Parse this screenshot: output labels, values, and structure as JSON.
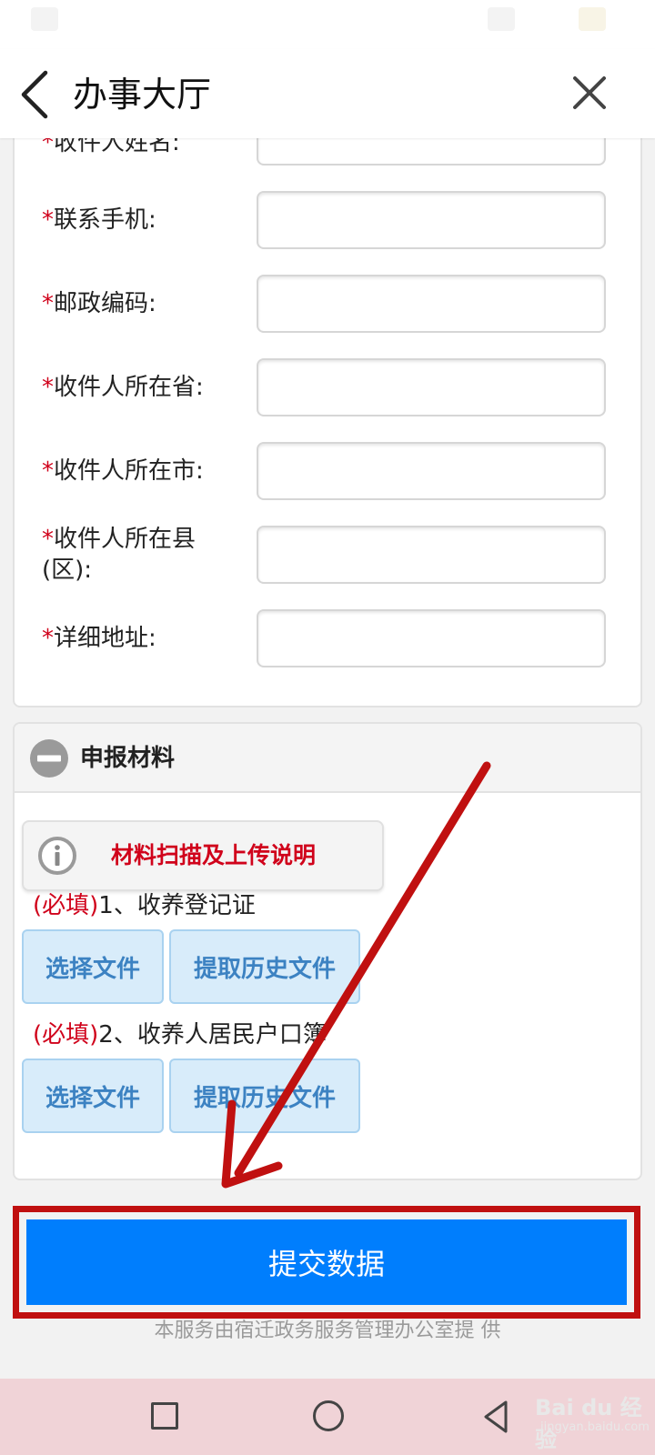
{
  "header": {
    "title": "办事大厅"
  },
  "form": {
    "partial_label": "收件人姓名:",
    "required_mark": "*",
    "fields": [
      {
        "label": "联系手机:"
      },
      {
        "label": "邮政编码:"
      },
      {
        "label": "收件人所在省:"
      },
      {
        "label": "收件人所在市:"
      },
      {
        "label": "收件人所在县\n(区):"
      },
      {
        "label": "详细地址:"
      }
    ]
  },
  "materials": {
    "section_title": "申报材料",
    "upload_note": "材料扫描及上传说明",
    "items": [
      {
        "tag": "(必填)",
        "name": "1、收养登记证",
        "select_label": "选择文件",
        "history_label": "提取历史文件"
      },
      {
        "tag": "(必填)",
        "name": "2、收养人居民户口簿",
        "select_label": "选择文件",
        "history_label": "提取历史文件"
      }
    ]
  },
  "submit": {
    "label": "提交数据"
  },
  "footer": {
    "note": "本服务由宿迁政务服务管理办公室提 供"
  },
  "watermark": {
    "brand": "Bai du 经验",
    "sub": "jingyan.baidu.com"
  },
  "colors": {
    "primary": "#007efd",
    "required": "#d0021b",
    "annotation": "#c01010",
    "file_button_bg": "#d8ecfa",
    "file_button_text": "#3c82c2"
  },
  "icons": {
    "back": "back-icon",
    "close": "close-icon",
    "collapse": "minus-circle-icon",
    "info": "info-icon"
  }
}
